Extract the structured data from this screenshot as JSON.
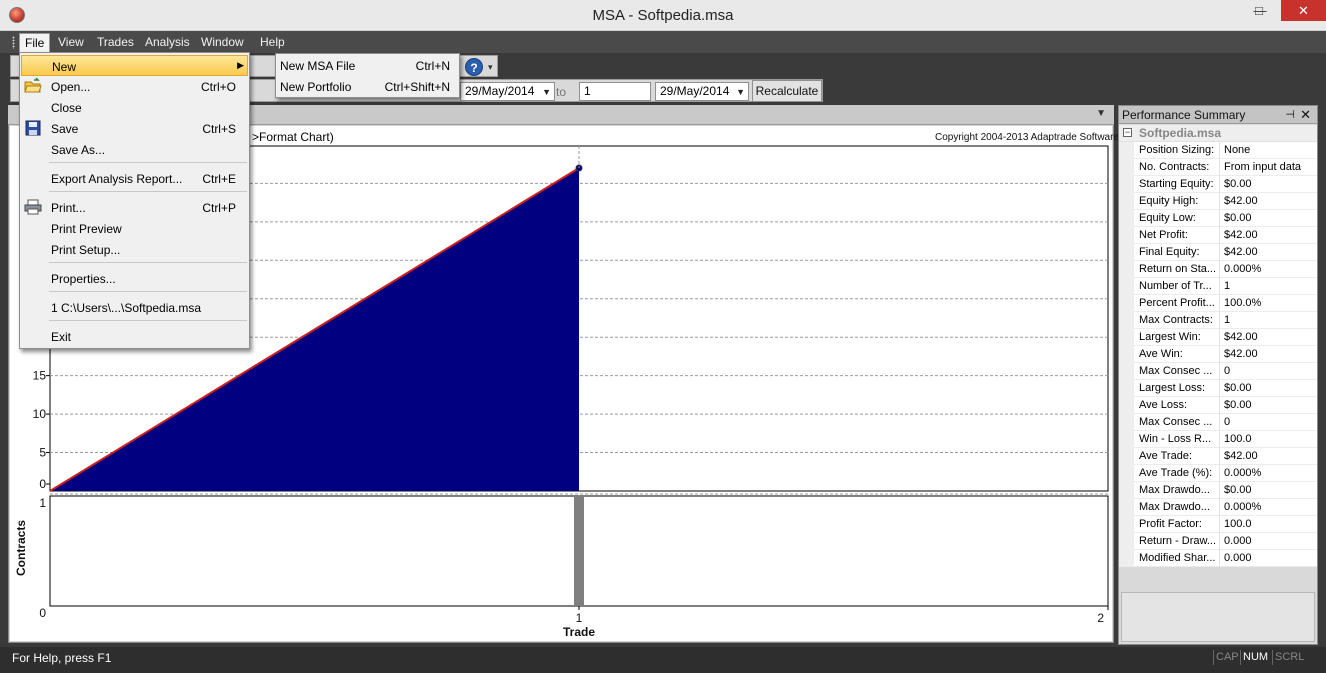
{
  "window": {
    "title": "MSA - Softpedia.msa",
    "min_glyph": "—",
    "max_glyph": "□",
    "close_glyph": "✕"
  },
  "menubar": {
    "items": [
      {
        "label": "File"
      },
      {
        "label": "View"
      },
      {
        "label": "Trades"
      },
      {
        "label": "Analysis"
      },
      {
        "label": "Window"
      },
      {
        "label": "Help"
      }
    ]
  },
  "file_menu": {
    "items": [
      {
        "label": "New",
        "shortcut": "",
        "submenu": true
      },
      {
        "label": "Open...",
        "shortcut": "Ctrl+O"
      },
      {
        "label": "Close",
        "shortcut": ""
      },
      {
        "label": "Save",
        "shortcut": "Ctrl+S"
      },
      {
        "label": "Save As...",
        "shortcut": ""
      },
      {
        "label": "Export Analysis Report...",
        "shortcut": "Ctrl+E"
      },
      {
        "label": "Print...",
        "shortcut": "Ctrl+P"
      },
      {
        "label": "Print Preview",
        "shortcut": ""
      },
      {
        "label": "Print Setup...",
        "shortcut": ""
      },
      {
        "label": "Properties...",
        "shortcut": ""
      },
      {
        "label": "1 C:\\Users\\...\\Softpedia.msa",
        "shortcut": ""
      },
      {
        "label": "Exit",
        "shortcut": ""
      }
    ],
    "submenu_arrow": "▶"
  },
  "new_submenu": {
    "items": [
      {
        "label": "New MSA File",
        "shortcut": "Ctrl+N"
      },
      {
        "label": "New Portfolio",
        "shortcut": "Ctrl+Shift+N"
      }
    ]
  },
  "toolbar": {
    "help_glyph": "?",
    "date_from": "29/May/2014",
    "to_label": "to",
    "trade_to": "1",
    "date_to": "29/May/2014",
    "dropdown_arrow": "▼",
    "recalculate_label": "Recalculate"
  },
  "chart_header": {
    "fragment": ">Format Chart)",
    "copyright": "Copyright 2004-2013 Adaptrade Software"
  },
  "chart_data": [
    {
      "type": "area",
      "x": [
        0,
        1
      ],
      "values": [
        0,
        42
      ],
      "ylim": [
        0,
        42
      ],
      "visible_yticks": [
        "15",
        "10",
        "5",
        "0"
      ],
      "fill_color": "#000080",
      "line_color": "#cc1f1f"
    },
    {
      "type": "bar",
      "x": [
        1
      ],
      "values": [
        1
      ],
      "ylabel": "Contracts",
      "xlabel": "Trade",
      "xlim": [
        0,
        2
      ],
      "ylim": [
        0,
        1
      ],
      "yticks": [
        "1",
        "0"
      ],
      "xticks": [
        "1",
        "2"
      ],
      "bar_color": "#7f7f7f"
    }
  ],
  "perf_summary": {
    "title": "Performance Summary",
    "pin_glyph": "⊣",
    "close_glyph": "✕",
    "category": "Softpedia.msa",
    "category_toggle": "−",
    "rows": [
      {
        "label": "Position Sizing:",
        "value": "None"
      },
      {
        "label": "No. Contracts:",
        "value": "From input data"
      },
      {
        "label": "Starting Equity:",
        "value": "$0.00"
      },
      {
        "label": "Equity High:",
        "value": "$42.00"
      },
      {
        "label": "Equity Low:",
        "value": "$0.00"
      },
      {
        "label": "Net Profit:",
        "value": "$42.00"
      },
      {
        "label": "Final Equity:",
        "value": "$42.00"
      },
      {
        "label": "Return on Sta...",
        "value": "0.000%"
      },
      {
        "label": "Number of Tr...",
        "value": "1"
      },
      {
        "label": "Percent Profit...",
        "value": "100.0%"
      },
      {
        "label": "Max Contracts:",
        "value": "1"
      },
      {
        "label": "Largest Win:",
        "value": "$42.00"
      },
      {
        "label": "Ave Win:",
        "value": "$42.00"
      },
      {
        "label": "Max Consec ...",
        "value": "0"
      },
      {
        "label": "Largest Loss:",
        "value": "$0.00"
      },
      {
        "label": "Ave Loss:",
        "value": "$0.00"
      },
      {
        "label": "Max Consec ...",
        "value": "0"
      },
      {
        "label": "Win - Loss R...",
        "value": "100.0"
      },
      {
        "label": "Ave Trade:",
        "value": "$42.00"
      },
      {
        "label": "Ave Trade (%):",
        "value": "0.000%"
      },
      {
        "label": "Max Drawdo...",
        "value": "$0.00"
      },
      {
        "label": "Max Drawdo...",
        "value": "0.000%"
      },
      {
        "label": "Profit Factor:",
        "value": "100.0"
      },
      {
        "label": "Return - Draw...",
        "value": "0.000"
      },
      {
        "label": "Modified Shar...",
        "value": "0.000"
      }
    ]
  },
  "statusbar": {
    "message": "For Help, press F1",
    "cap": "CAP",
    "num": "NUM",
    "scrl": "SCRL"
  }
}
